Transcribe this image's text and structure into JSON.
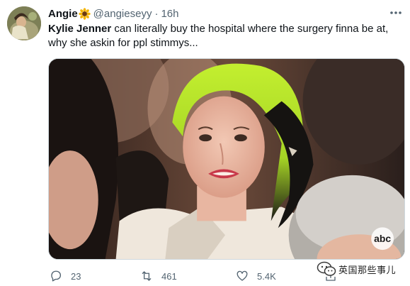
{
  "tweet": {
    "author": {
      "display_name": "Angie",
      "display_emoji_icon": "sunflower-icon",
      "handle": "@angieseyy",
      "separator": "·",
      "time": "16h"
    },
    "text": {
      "mention": "Kylie Jenner",
      "body": " can literally buy the hospital where the surgery finna be at, why she askin for ppl stimmys..."
    },
    "media": {
      "type": "photo",
      "broadcaster_logo": "abc"
    },
    "actions": {
      "reply_count": "23",
      "retweet_count": "461",
      "like_count": "5.4K"
    },
    "icons": {
      "reply": "reply-icon",
      "retweet": "retweet-icon",
      "like": "like-icon",
      "share": "share-icon",
      "more": "more-icon"
    }
  },
  "watermark": {
    "text": "英国那些事儿",
    "icon": "wechat-icon"
  },
  "colors": {
    "text_primary": "#0f1419",
    "text_secondary": "#536471",
    "border": "#cfd9de",
    "hair_green": "#b8e62a"
  }
}
